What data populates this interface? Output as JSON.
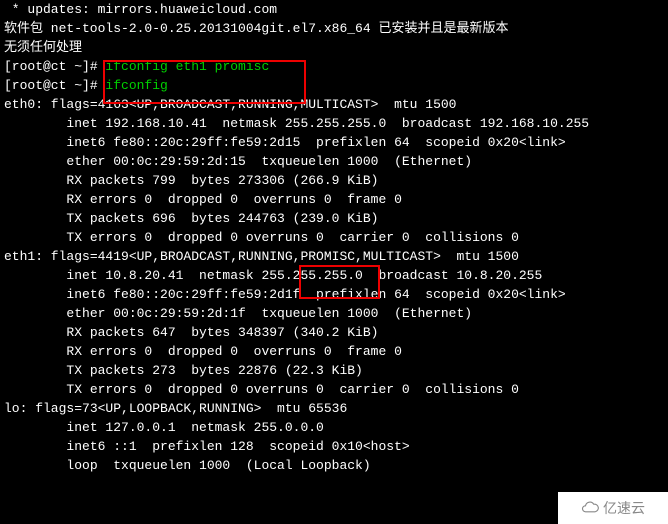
{
  "lines": [
    {
      "cls": "white",
      "indent": 0,
      "text": " * updates: mirrors.huaweicloud.com"
    },
    {
      "cls": "white",
      "indent": 0,
      "text": "软件包 net-tools-2.0-0.25.20131004git.el7.x86_64 已安装并且是最新版本"
    },
    {
      "cls": "white",
      "indent": 0,
      "text": "无须任何处理"
    },
    {
      "cls": "prompt",
      "indent": 0,
      "prompt": "[root@ct ~]# ",
      "cmd": "ifconfig eth1 promisc"
    },
    {
      "cls": "prompt",
      "indent": 0,
      "prompt": "[root@ct ~]# ",
      "cmd": "ifconfig"
    },
    {
      "cls": "white",
      "indent": 0,
      "text": "eth0: flags=4163<UP,BROADCAST,RUNNING,MULTICAST>  mtu 1500"
    },
    {
      "cls": "white",
      "indent": 8,
      "text": "inet 192.168.10.41  netmask 255.255.255.0  broadcast 192.168.10.255"
    },
    {
      "cls": "white",
      "indent": 8,
      "text": "inet6 fe80::20c:29ff:fe59:2d15  prefixlen 64  scopeid 0x20<link>"
    },
    {
      "cls": "white",
      "indent": 8,
      "text": "ether 00:0c:29:59:2d:15  txqueuelen 1000  (Ethernet)"
    },
    {
      "cls": "white",
      "indent": 8,
      "text": "RX packets 799  bytes 273306 (266.9 KiB)"
    },
    {
      "cls": "white",
      "indent": 8,
      "text": "RX errors 0  dropped 0  overruns 0  frame 0"
    },
    {
      "cls": "white",
      "indent": 8,
      "text": "TX packets 696  bytes 244763 (239.0 KiB)"
    },
    {
      "cls": "white",
      "indent": 8,
      "text": "TX errors 0  dropped 0 overruns 0  carrier 0  collisions 0"
    },
    {
      "cls": "white",
      "indent": 0,
      "text": ""
    },
    {
      "cls": "white",
      "indent": 0,
      "text": "eth1: flags=4419<UP,BROADCAST,RUNNING,PROMISC,MULTICAST>  mtu 1500"
    },
    {
      "cls": "white",
      "indent": 8,
      "text": "inet 10.8.20.41  netmask 255.255.255.0  broadcast 10.8.20.255"
    },
    {
      "cls": "white",
      "indent": 8,
      "text": "inet6 fe80::20c:29ff:fe59:2d1f  prefixlen 64  scopeid 0x20<link>"
    },
    {
      "cls": "white",
      "indent": 8,
      "text": "ether 00:0c:29:59:2d:1f  txqueuelen 1000  (Ethernet)"
    },
    {
      "cls": "white",
      "indent": 8,
      "text": "RX packets 647  bytes 348397 (340.2 KiB)"
    },
    {
      "cls": "white",
      "indent": 8,
      "text": "RX errors 0  dropped 0  overruns 0  frame 0"
    },
    {
      "cls": "white",
      "indent": 8,
      "text": "TX packets 273  bytes 22876 (22.3 KiB)"
    },
    {
      "cls": "white",
      "indent": 8,
      "text": "TX errors 0  dropped 0 overruns 0  carrier 0  collisions 0"
    },
    {
      "cls": "white",
      "indent": 0,
      "text": ""
    },
    {
      "cls": "white",
      "indent": 0,
      "text": "lo: flags=73<UP,LOOPBACK,RUNNING>  mtu 65536"
    },
    {
      "cls": "white",
      "indent": 8,
      "text": "inet 127.0.0.1  netmask 255.0.0.0"
    },
    {
      "cls": "white",
      "indent": 8,
      "text": "inet6 ::1  prefixlen 128  scopeid 0x10<host>"
    },
    {
      "cls": "white",
      "indent": 8,
      "text": "loop  txqueuelen 1000  (Local Loopback)"
    }
  ],
  "watermark": "亿速云"
}
